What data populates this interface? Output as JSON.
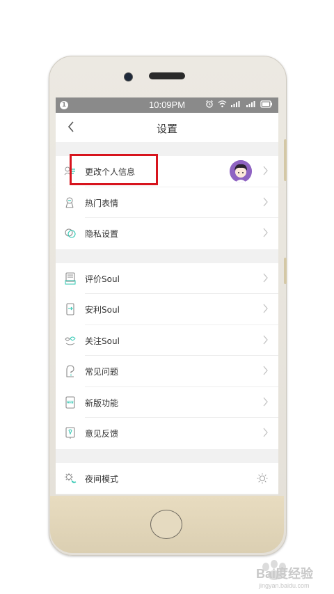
{
  "status_bar": {
    "notification_badge": "1",
    "time": "10:09PM",
    "icons": [
      "alarm-icon",
      "wifi-icon",
      "signal-icon",
      "signal-icon",
      "battery-icon"
    ]
  },
  "header": {
    "back_icon": "chevron-left-icon",
    "title": "设置"
  },
  "groups": [
    {
      "items": [
        {
          "label": "更改个人信息",
          "icon": "profile-icon",
          "has_avatar": true,
          "highlighted": true
        },
        {
          "label": "热门表情",
          "icon": "sticker-icon"
        },
        {
          "label": "隐私设置",
          "icon": "privacy-icon"
        }
      ]
    },
    {
      "items": [
        {
          "label": "评价Soul",
          "icon": "rate-icon"
        },
        {
          "label": "安利Soul",
          "icon": "share-icon"
        },
        {
          "label": "关注Soul",
          "icon": "soul-logo-icon"
        },
        {
          "label": "常见问题",
          "icon": "question-icon"
        },
        {
          "label": "新版功能",
          "icon": "new-feature-icon"
        },
        {
          "label": "意见反馈",
          "icon": "feedback-icon"
        }
      ]
    },
    {
      "items": [
        {
          "label": "夜间模式",
          "icon": "night-mode-icon",
          "trailing_icon": "sun-icon"
        }
      ]
    }
  ],
  "watermark": {
    "brand": "Bai度经验",
    "url": "jingyan.baidu.com"
  },
  "colors": {
    "highlight_box": "#d7141d",
    "icon_teal": "#2fc7b2",
    "avatar_bg": "#8f63c2",
    "status_bar": "#8a8a8a"
  }
}
